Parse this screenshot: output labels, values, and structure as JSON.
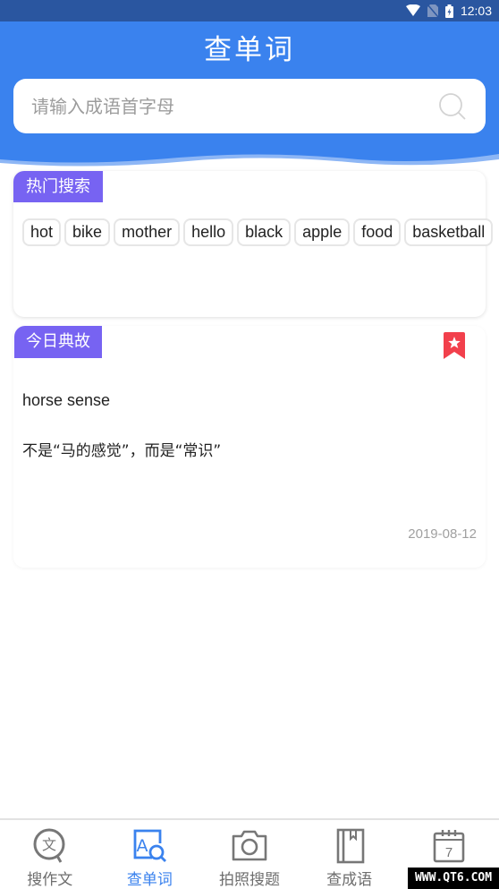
{
  "status_bar": {
    "time": "12:03",
    "icons": [
      "wifi-icon",
      "no-sim-icon",
      "battery-charging-icon"
    ]
  },
  "header": {
    "title": "查单词",
    "search": {
      "placeholder": "请输入成语首字母",
      "value": "",
      "icon": "search-icon"
    }
  },
  "hot_search": {
    "label": "热门搜索",
    "chips": [
      "hot",
      "bike",
      "mother",
      "hello",
      "black",
      "apple",
      "food",
      "basketball"
    ]
  },
  "today_story": {
    "label": "今日典故",
    "bookmark_icon": "bookmark-star-icon",
    "word": "horse sense",
    "meaning": "不是“马的感觉”，而是“常识”",
    "date": "2019-08-12"
  },
  "bottom_nav": {
    "items": [
      {
        "label": "搜作文",
        "icon": "search-essay-icon",
        "active": false
      },
      {
        "label": "查单词",
        "icon": "lookup-word-icon",
        "active": true
      },
      {
        "label": "拍照搜题",
        "icon": "camera-icon",
        "active": false
      },
      {
        "label": "查成语",
        "icon": "book-icon",
        "active": false
      },
      {
        "label": "",
        "icon": "calendar-icon",
        "active": false
      }
    ]
  },
  "watermark": "WWW.QT6.COM",
  "colors": {
    "primary": "#3a82ee",
    "tag": "#7763f2",
    "bookmark": "#f2404c",
    "status_bar": "#2a56a0"
  }
}
